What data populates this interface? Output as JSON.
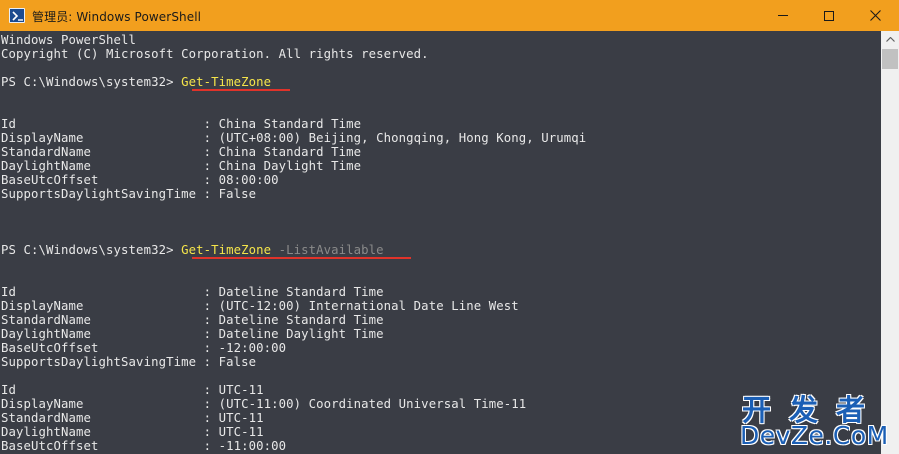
{
  "window": {
    "title": "管理员: Windows PowerShell",
    "icon": "powershell-icon",
    "controls": {
      "minimize": "minimize-icon",
      "maximize": "maximize-icon",
      "close": "close-icon"
    }
  },
  "colors": {
    "titlebar": "#f29f1e",
    "console_bg": "#3a3d45",
    "console_text": "#e8e8e8",
    "command": "#f5e54a",
    "parameter": "#8a8a8a",
    "annotation": "#e0332a",
    "watermark": "#1b5fb5"
  },
  "console": {
    "header_line1": "Windows PowerShell",
    "header_line2": "Copyright (C) Microsoft Corporation. All rights reserved.",
    "prompt1": "PS C:\\Windows\\system32> ",
    "command1": "Get-TimeZone",
    "result1": [
      "Id                         : China Standard Time",
      "DisplayName                : (UTC+08:00) Beijing, Chongqing, Hong Kong, Urumqi",
      "StandardName               : China Standard Time",
      "DaylightName               : China Daylight Time",
      "BaseUtcOffset              : 08:00:00",
      "SupportsDaylightSavingTime : False"
    ],
    "prompt2": "PS C:\\Windows\\system32> ",
    "command2": "Get-TimeZone",
    "parameter2": " -ListAvailable",
    "result2": [
      "Id                         : Dateline Standard Time",
      "DisplayName                : (UTC-12:00) International Date Line West",
      "StandardName               : Dateline Standard Time",
      "DaylightName               : Dateline Daylight Time",
      "BaseUtcOffset              : -12:00:00",
      "SupportsDaylightSavingTime : False"
    ],
    "result3": [
      "Id                         : UTC-11",
      "DisplayName                : (UTC-11:00) Coordinated Universal Time-11",
      "StandardName               : UTC-11",
      "DaylightName               : UTC-11",
      "BaseUtcOffset              : -11:00:00"
    ]
  },
  "watermark": {
    "cn": "开发者",
    "en": "DevZe.CoM"
  }
}
